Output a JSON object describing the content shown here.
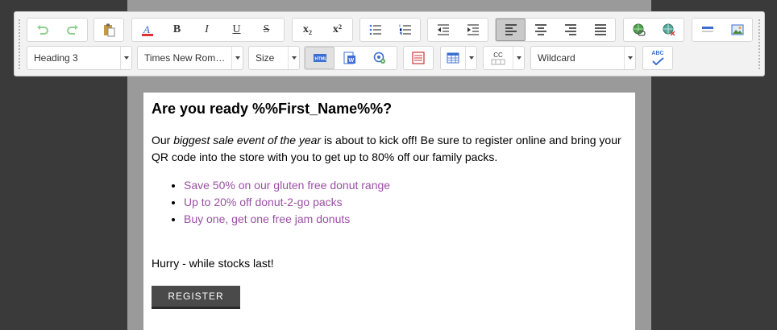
{
  "toolbar": {
    "heading_select": "Heading 3",
    "font_select": "Times New Rom…",
    "size_select": "Size",
    "wildcard_select": "Wildcard",
    "bold": "B",
    "italic": "I",
    "underline": "U",
    "strike": "S",
    "subscript": "x₂",
    "superscript": "x²",
    "cc_label": "CC",
    "abc_label": "ABC"
  },
  "document": {
    "heading": "Are you ready %%First_Name%%?",
    "para_pre": "Our ",
    "para_em": "biggest sale event of the year",
    "para_post": " is about to kick off! Be sure to register online and bring your QR code into the store with you to get up to 80% off our family packs.",
    "list": [
      "Save 50% on our gluten free donut range",
      "Up to 20% off donut-2-go packs",
      "Buy one, get one free jam donuts"
    ],
    "hurry": "Hurry - while stocks last!",
    "button": "REGISTER"
  },
  "colors": {
    "link_purple": "#9b4fa5",
    "button_bg": "#4a4a4a"
  }
}
